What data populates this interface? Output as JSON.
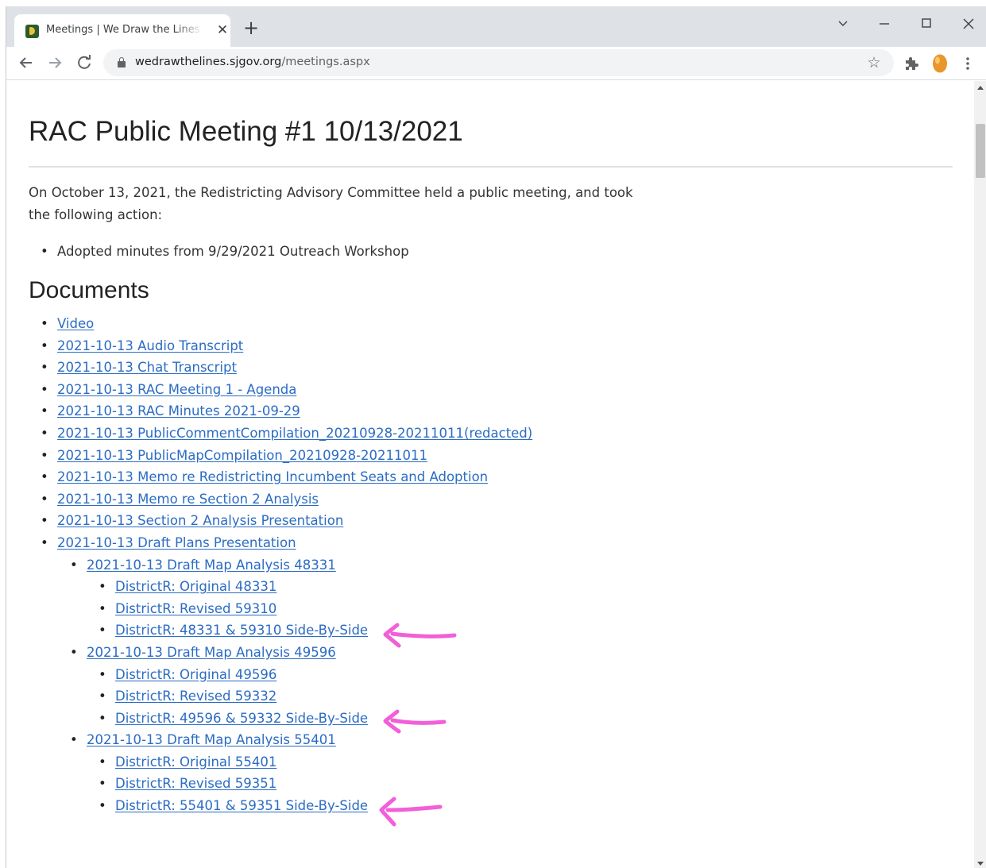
{
  "browser": {
    "tab": {
      "title": "Meetings | We Draw the Lines | S",
      "close_glyph": "✕"
    },
    "new_tab_glyph": "+",
    "address": {
      "host": "wedrawthelines.sjgov.org",
      "path": "/meetings.aspx"
    }
  },
  "page": {
    "title": "RAC Public Meeting #1 10/13/2021",
    "intro": "On October 13, 2021, the Redistricting Advisory Committee held a public meeting, and took the following action:",
    "actions": [
      "Adopted minutes from 9/29/2021 Outreach Workshop"
    ],
    "documents_heading": "Documents",
    "documents": [
      {
        "label": "Video",
        "level": 0
      },
      {
        "label": "2021-10-13 Audio Transcript",
        "level": 0
      },
      {
        "label": "2021-10-13 Chat Transcript",
        "level": 0
      },
      {
        "label": "2021-10-13 RAC Meeting 1 - Agenda",
        "level": 0
      },
      {
        "label": "2021-10-13 RAC Minutes 2021-09-29",
        "level": 0
      },
      {
        "label": "2021-10-13 PublicCommentCompilation_20210928-20211011(redacted)",
        "level": 0
      },
      {
        "label": "2021-10-13 PublicMapCompilation_20210928-20211011",
        "level": 0
      },
      {
        "label": "2021-10-13 Memo re Redistricting Incumbent Seats and Adoption",
        "level": 0
      },
      {
        "label": "2021-10-13 Memo re Section 2 Analysis",
        "level": 0
      },
      {
        "label": "2021-10-13 Section 2 Analysis Presentation",
        "level": 0
      },
      {
        "label": "2021-10-13 Draft Plans Presentation",
        "level": 0
      },
      {
        "label": "2021-10-13 Draft Map Analysis 48331",
        "level": 1
      },
      {
        "label": "DistrictR: Original 48331",
        "level": 2
      },
      {
        "label": "DistrictR: Revised 59310",
        "level": 2
      },
      {
        "label": "DistrictR: 48331 & 59310 Side-By-Side",
        "level": 2
      },
      {
        "label": "2021-10-13 Draft Map Analysis 49596",
        "level": 1
      },
      {
        "label": "DistrictR: Original 49596",
        "level": 2
      },
      {
        "label": "DistrictR: Revised 59332",
        "level": 2
      },
      {
        "label": "DistrictR: 49596 & 59332 Side-By-Side",
        "level": 2
      },
      {
        "label": "2021-10-13 Draft Map Analysis 55401",
        "level": 1
      },
      {
        "label": "DistrictR: Original 55401",
        "level": 2
      },
      {
        "label": "DistrictR: Revised 59351",
        "level": 2
      },
      {
        "label": "DistrictR: 55401 & 59351 Side-By-Side",
        "level": 2
      }
    ]
  },
  "colors": {
    "link": "#2b6cc4",
    "annotation": "#f25fd8",
    "tab_strip": "#dee1e6",
    "omnibox": "#f1f3f4"
  },
  "icons": [
    "tablist-chevron-icon",
    "minimize-icon",
    "maximize-icon",
    "close-icon",
    "back-arrow-icon",
    "forward-arrow-icon",
    "reload-icon",
    "lock-icon",
    "star-icon",
    "extensions-puzzle-icon",
    "profile-egg-icon",
    "kebab-menu-icon",
    "hand-drawn-arrow-icon"
  ]
}
